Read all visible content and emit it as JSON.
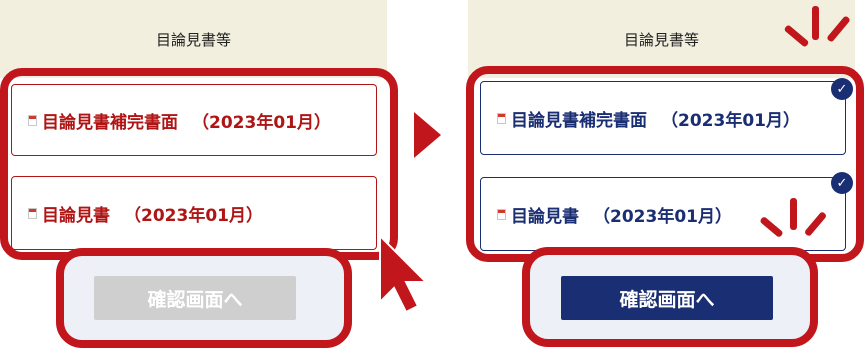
{
  "before": {
    "header": "目論見書等",
    "documents": [
      {
        "title": "目論見書補完書面",
        "date": "（2023年01月）"
      },
      {
        "title": "目論見書",
        "date": "（2023年01月）"
      }
    ],
    "confirm_button": "確認画面へ",
    "button_state": "disabled"
  },
  "after": {
    "header": "目論見書等",
    "documents": [
      {
        "title": "目論見書補完書面",
        "date": "（2023年01月）",
        "checked": true
      },
      {
        "title": "目論見書",
        "date": "（2023年01月）",
        "checked": true
      }
    ],
    "confirm_button": "確認画面へ",
    "button_state": "enabled"
  },
  "colors": {
    "highlight": "#c1161b",
    "header_bg": "#f2efdf",
    "unread_text": "#b01515",
    "read_text": "#1a2e73",
    "button_disabled": "#cfcfcf",
    "button_enabled": "#1a2e73"
  },
  "icons": [
    "document-icon",
    "check-circle-icon",
    "arrow-right-icon",
    "cursor-arrow-icon",
    "sparkle-icon"
  ]
}
